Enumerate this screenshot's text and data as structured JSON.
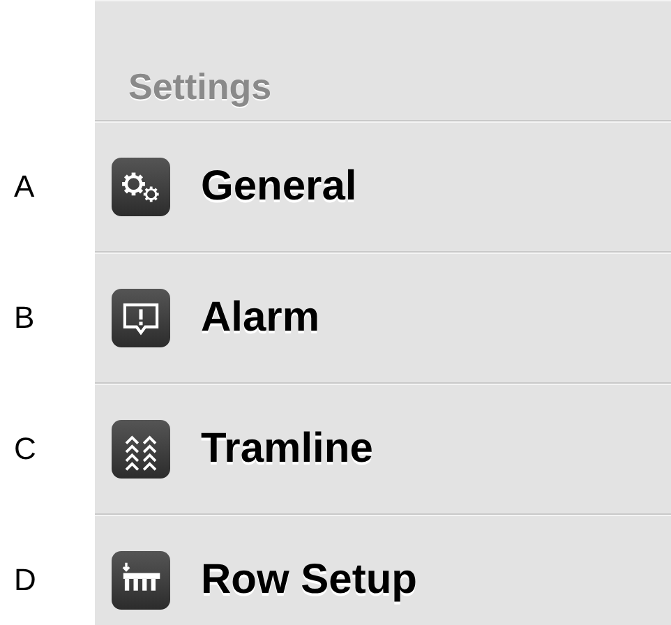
{
  "header": {
    "title": "Settings"
  },
  "items": [
    {
      "letter": "A",
      "label": "General"
    },
    {
      "letter": "B",
      "label": "Alarm"
    },
    {
      "letter": "C",
      "label": "Tramline"
    },
    {
      "letter": "D",
      "label": "Row Setup"
    }
  ]
}
